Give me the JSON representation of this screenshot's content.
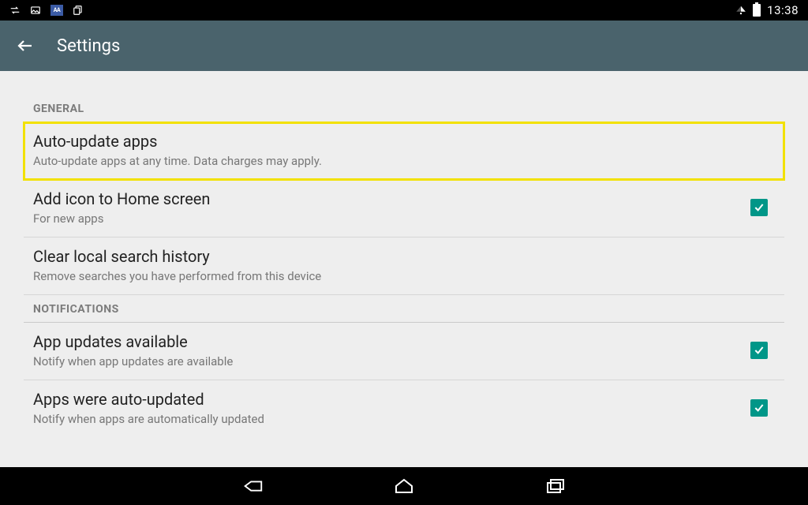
{
  "statusbar": {
    "badge": "AA",
    "clock": "13:38"
  },
  "appbar": {
    "title": "Settings"
  },
  "sections": {
    "general_header": "GENERAL",
    "notifications_header": "NOTIFICATIONS"
  },
  "rows": {
    "auto_update": {
      "title": "Auto-update apps",
      "sub": "Auto-update apps at any time. Data charges may apply."
    },
    "add_icon": {
      "title": "Add icon to Home screen",
      "sub": "For new apps",
      "checked": true
    },
    "clear_history": {
      "title": "Clear local search history",
      "sub": "Remove searches you have performed from this device"
    },
    "updates_available": {
      "title": "App updates available",
      "sub": "Notify when app updates are available",
      "checked": true
    },
    "auto_updated": {
      "title": "Apps were auto-updated",
      "sub": "Notify when apps are automatically updated",
      "checked": true
    }
  }
}
